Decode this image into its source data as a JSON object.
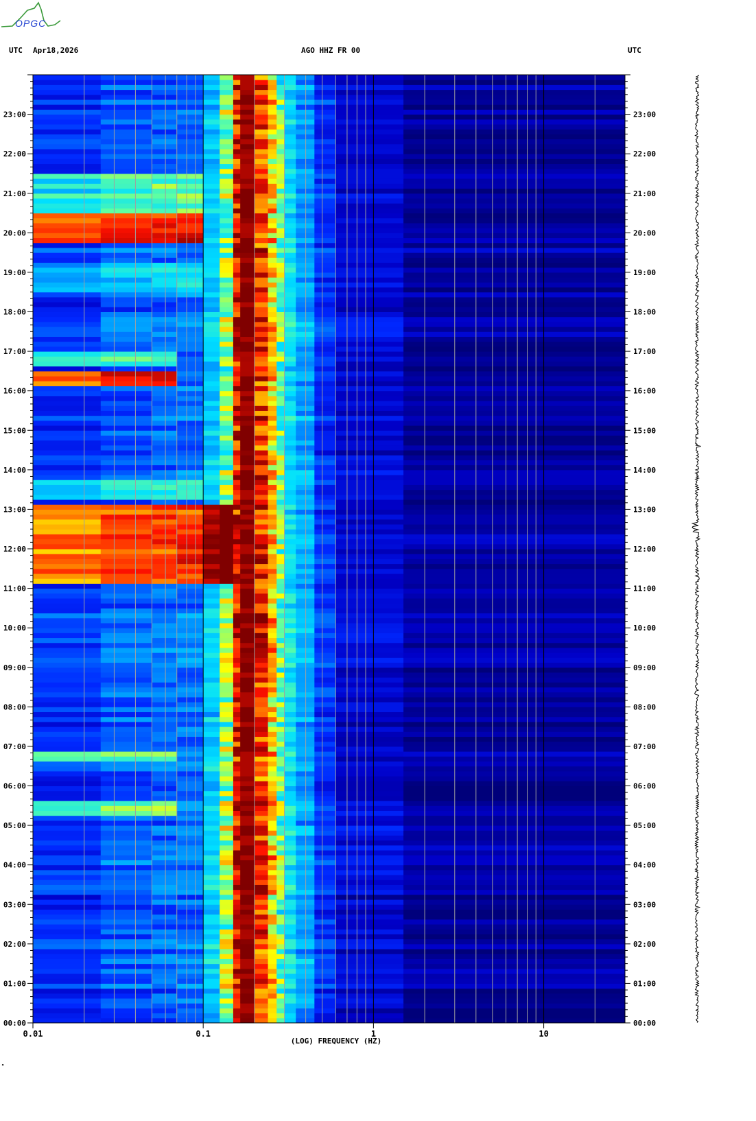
{
  "header": {
    "logo_text": "OPGC",
    "left_tz": "UTC",
    "date": "Apr18,2026",
    "station": "AGO HHZ FR 00",
    "right_tz": "UTC"
  },
  "footer_mark": "ᴹ",
  "chart_data": {
    "type": "heatmap",
    "title": "AGO HHZ FR 00",
    "xlabel": "(LOG) FREQUENCY (HZ)",
    "xscale": "log",
    "xlim": [
      0.01,
      30
    ],
    "x_tick_labels": [
      {
        "value": 0.01,
        "label": "0.01"
      },
      {
        "value": 0.1,
        "label": "0.1"
      },
      {
        "value": 1,
        "label": "1"
      },
      {
        "value": 10,
        "label": "10"
      }
    ],
    "ylabel": "UTC",
    "ylim_hours": [
      0,
      24
    ],
    "y_tick_labels": [
      "00:00",
      "01:00",
      "02:00",
      "03:00",
      "04:00",
      "05:00",
      "06:00",
      "07:00",
      "08:00",
      "09:00",
      "10:00",
      "11:00",
      "12:00",
      "13:00",
      "14:00",
      "15:00",
      "16:00",
      "17:00",
      "18:00",
      "19:00",
      "20:00",
      "21:00",
      "22:00",
      "23:00"
    ],
    "colormap": [
      "#00007a",
      "#0000c8",
      "#0028ff",
      "#0090ff",
      "#00e0ff",
      "#60ffa0",
      "#ffff00",
      "#ff9000",
      "#ff1000",
      "#800000"
    ],
    "bands": [
      {
        "f0": 0.01,
        "f1": 0.025,
        "level": 0.22
      },
      {
        "f0": 0.025,
        "f1": 0.05,
        "level": 0.27
      },
      {
        "f0": 0.05,
        "f1": 0.07,
        "level": 0.29
      },
      {
        "f0": 0.07,
        "f1": 0.1,
        "level": 0.3
      },
      {
        "f0": 0.1,
        "f1": 0.125,
        "level": 0.42
      },
      {
        "f0": 0.125,
        "f1": 0.15,
        "level": 0.6
      },
      {
        "f0": 0.15,
        "f1": 0.165,
        "level": 0.9
      },
      {
        "f0": 0.165,
        "f1": 0.2,
        "level": 1.0
      },
      {
        "f0": 0.2,
        "f1": 0.24,
        "level": 0.86
      },
      {
        "f0": 0.24,
        "f1": 0.27,
        "level": 0.72
      },
      {
        "f0": 0.27,
        "f1": 0.3,
        "level": 0.56
      },
      {
        "f0": 0.3,
        "f1": 0.35,
        "level": 0.45
      },
      {
        "f0": 0.35,
        "f1": 0.45,
        "level": 0.36
      },
      {
        "f0": 0.45,
        "f1": 0.6,
        "level": 0.22
      },
      {
        "f0": 0.6,
        "f1": 1.5,
        "level": 0.13
      },
      {
        "f0": 1.5,
        "f1": 30,
        "level": 0.05
      }
    ],
    "events": [
      {
        "t0": 11.1,
        "t1": 13.1,
        "fmax": 0.15,
        "boost": 0.55
      },
      {
        "t0": 16.1,
        "t1": 16.5,
        "fmax": 0.07,
        "boost": 0.6
      },
      {
        "t0": 19.8,
        "t1": 20.5,
        "fmax": 0.1,
        "boost": 0.6
      },
      {
        "t0": 20.5,
        "t1": 21.5,
        "fmax": 0.1,
        "boost": 0.25
      },
      {
        "t0": 16.6,
        "t1": 17.0,
        "fmax": 0.07,
        "boost": 0.25
      },
      {
        "t0": 6.6,
        "t1": 6.9,
        "fmax": 0.07,
        "boost": 0.3
      },
      {
        "t0": 5.2,
        "t1": 5.6,
        "fmax": 0.07,
        "boost": 0.25
      },
      {
        "t0": 13.2,
        "t1": 13.8,
        "fmax": 0.1,
        "boost": 0.2
      },
      {
        "t0": 18.5,
        "t1": 19.3,
        "fmax": 0.1,
        "boost": 0.15
      }
    ],
    "waveform_burst_hours": [
      12.5,
      11.3,
      2.95,
      14.6,
      8.3
    ]
  }
}
